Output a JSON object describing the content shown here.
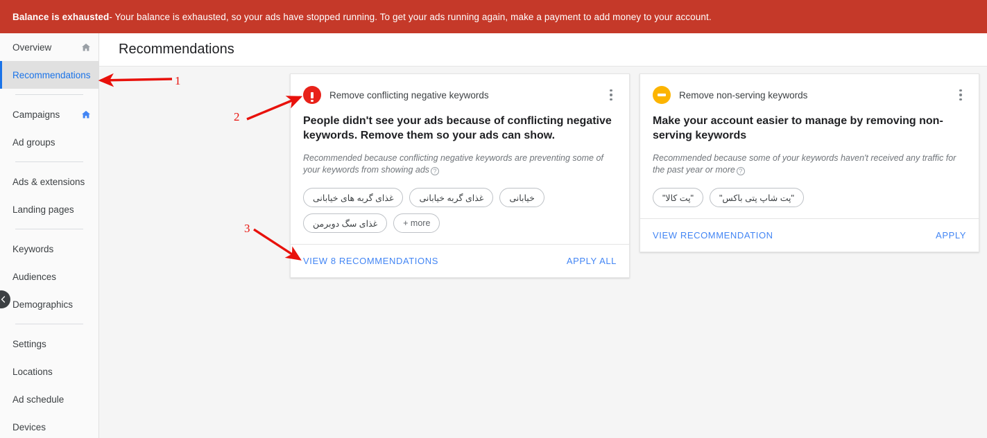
{
  "alert": {
    "strong": "Balance is exhausted",
    "rest": " - Your balance is exhausted, so your ads have stopped running. To get your ads running again, make a payment to add money to your account."
  },
  "header": {
    "title": "Recommendations"
  },
  "sidebar": {
    "items": [
      {
        "label": "Overview",
        "icon": "home-icon",
        "icon_color": "#9aa0a6",
        "active": false
      },
      {
        "label": "Recommendations",
        "icon": null,
        "active": true
      },
      {
        "divider": true
      },
      {
        "label": "Campaigns",
        "icon": "home-icon",
        "icon_color": "#4285f4",
        "active": false
      },
      {
        "label": "Ad groups",
        "icon": null,
        "active": false
      },
      {
        "divider": true
      },
      {
        "label": "Ads & extensions",
        "icon": null,
        "active": false
      },
      {
        "label": "Landing pages",
        "icon": null,
        "active": false
      },
      {
        "divider": true
      },
      {
        "label": "Keywords",
        "icon": null,
        "active": false
      },
      {
        "label": "Audiences",
        "icon": null,
        "active": false
      },
      {
        "label": "Demographics",
        "icon": null,
        "active": false
      },
      {
        "divider": true
      },
      {
        "label": "Settings",
        "icon": null,
        "active": false
      },
      {
        "label": "Locations",
        "icon": null,
        "active": false
      },
      {
        "label": "Ad schedule",
        "icon": null,
        "active": false
      },
      {
        "label": "Devices",
        "icon": null,
        "active": false
      }
    ],
    "collapse_icon": "chevron-left-icon"
  },
  "cards": [
    {
      "badge": {
        "type": "alert-icon",
        "color": "#e8221a"
      },
      "kicker": "Remove conflicting negative keywords",
      "headline": "People didn't see your ads because of conflicting negative keywords. Remove them so your ads can show.",
      "reason": "Recommended because conflicting negative keywords are preventing some of your keywords from showing ads",
      "help_icon": "help-circle-icon",
      "menu_icon": "more-vertical-icon",
      "chips": [
        "غذای گربه های خیابانی",
        "غذای گربه خیابانی",
        "خیابانی",
        "غذای سگ دوبرمن",
        "+ more"
      ],
      "primary_action": "VIEW 8 RECOMMENDATIONS",
      "secondary_action": "APPLY ALL"
    },
    {
      "badge": {
        "type": "pause-icon",
        "color": "#fcb400"
      },
      "kicker": "Remove non-serving keywords",
      "headline": "Make your account easier to manage by removing non-serving keywords",
      "reason": "Recommended because some of your keywords haven't received any traffic for the past year or more",
      "help_icon": "help-circle-icon",
      "menu_icon": "more-vertical-icon",
      "chips": [
        "\"پت کالا\"",
        "\"پت شاپ پتی باکس\""
      ],
      "primary_action": "VIEW RECOMMENDATION",
      "secondary_action": "APPLY"
    }
  ],
  "annotations": {
    "color": "#e8110b",
    "markers": [
      {
        "number": "1"
      },
      {
        "number": "2"
      },
      {
        "number": "3"
      }
    ]
  },
  "theme": {
    "banner_red": "#c53929",
    "link_blue": "#4285f4",
    "active_blue": "#1a73e8",
    "page_bg": "#f5f5f5"
  }
}
